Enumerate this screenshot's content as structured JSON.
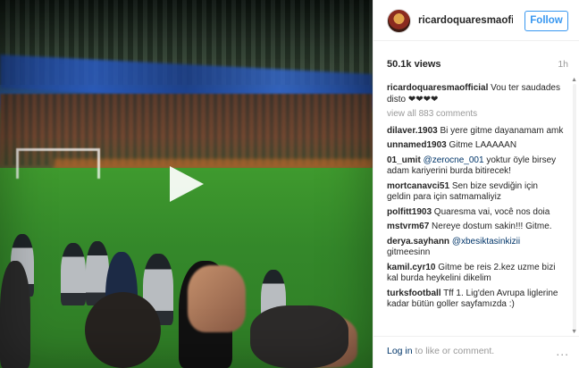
{
  "video": {
    "play_icon": "play-icon"
  },
  "header": {
    "username": "ricardoquaresmaofi...",
    "follow_label": "Follow"
  },
  "stats": {
    "views": "50.1k views",
    "age": "1h"
  },
  "caption": {
    "user": "ricardoquaresmaofficial",
    "text": "Vou ter saudades disto ❤❤❤❤"
  },
  "view_all": "view all 883 comments",
  "comments": [
    {
      "user": "dilaver.1903",
      "text": "Bi yere gitme dayanamam amk"
    },
    {
      "user": "unnamed1903",
      "text": "Gitme LAAAAAN"
    },
    {
      "user": "01_umit",
      "mention": "@zerocne_001",
      "text": "yoktur öyle birsey adam kariyerini burda bitirecek!"
    },
    {
      "user": "mortcanavci51",
      "text": "Sen bize sevdiğin için geldin para için satmamaliyiz"
    },
    {
      "user": "polfitt1903",
      "text": "Quaresma vai, você nos doia"
    },
    {
      "user": "mstvrm67",
      "text": "Nereye dostum sakin!!! Gitme."
    },
    {
      "user": "derya.sayhann",
      "mention": "@xbesiktasinkizii",
      "text": "gitmeesinn"
    },
    {
      "user": "kamil.cyr10",
      "text": "Gitme be reis 2.kez uzme bizi kal burda heykelini dikelim"
    },
    {
      "user": "turksfootball",
      "text": "Tff 1. Lig'den Avrupa liglerine kadar bütün goller sayfamızda :)"
    }
  ],
  "footer": {
    "login_link": "Log in",
    "login_rest": " to like or comment.",
    "more_icon": "more-options-icon",
    "more_glyph": "..."
  }
}
